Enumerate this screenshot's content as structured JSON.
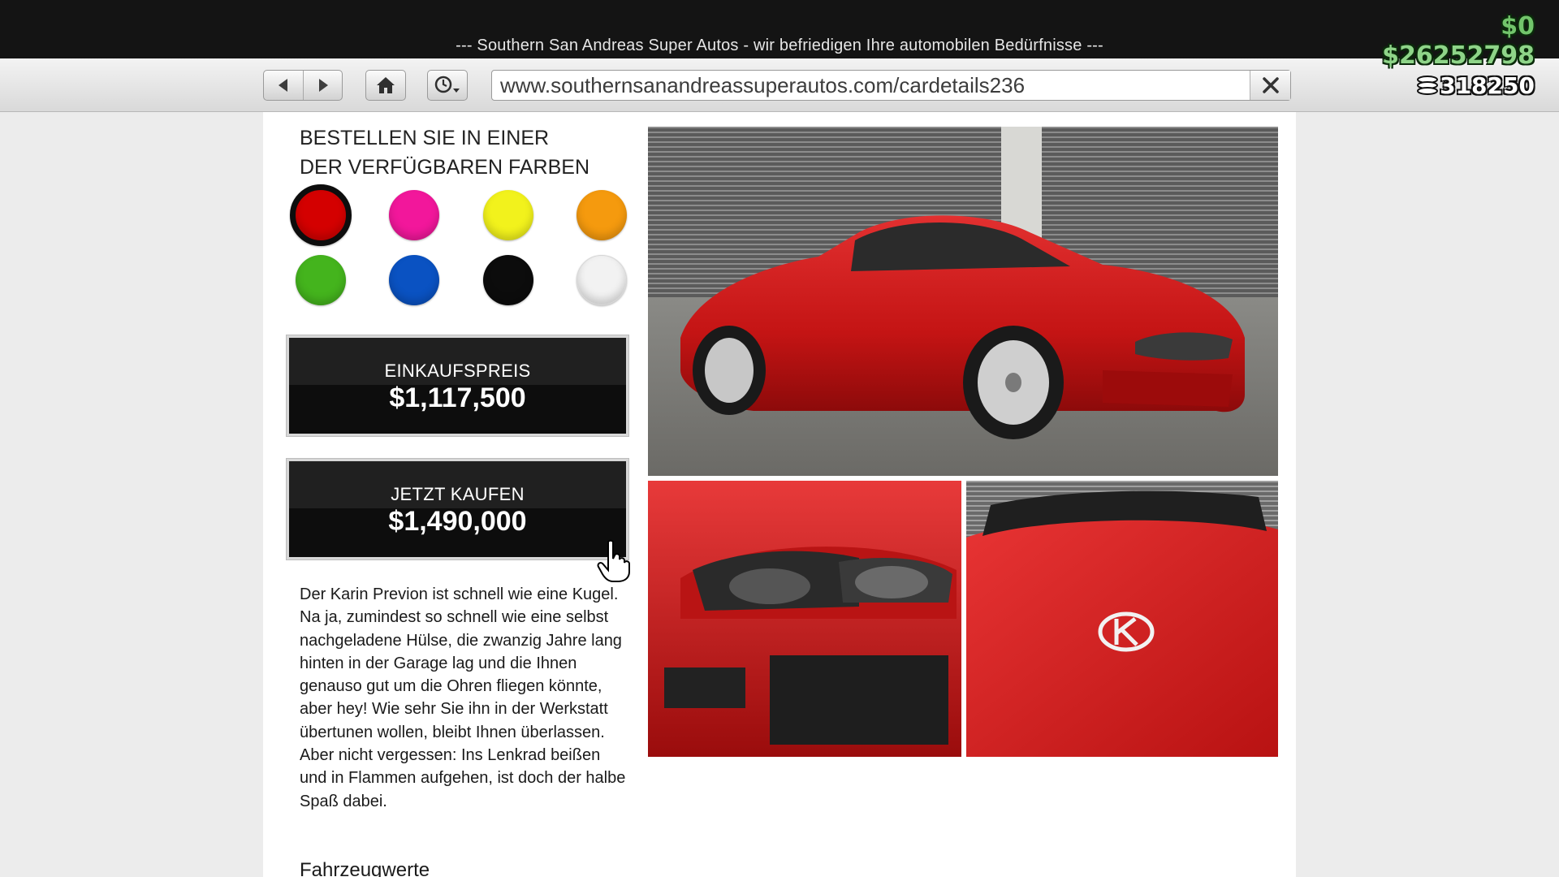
{
  "window": {
    "title": "--- Southern San Andreas Super Autos - wir befriedigen Ihre automobilen Bedürfnisse ---"
  },
  "toolbar": {
    "back_icon": "back-arrow-icon",
    "forward_icon": "forward-arrow-icon",
    "home_icon": "home-icon",
    "history_icon": "history-clock-icon",
    "url": "www.southernsanandreassuperautos.com/cardetails236",
    "close_icon": "close-icon"
  },
  "hud": {
    "cash": "$0",
    "bank": "$26252798",
    "chips": "318250",
    "chips_icon": "chips-icon"
  },
  "colors": {
    "heading": "BESTELLEN SIE IN EINER DER VERFÜGBAREN FARBEN",
    "swatches": [
      {
        "name": "red",
        "hex": "#d40000",
        "selected": true
      },
      {
        "name": "pink",
        "hex": "#f2179b",
        "selected": false
      },
      {
        "name": "yellow",
        "hex": "#f2f21c",
        "selected": false
      },
      {
        "name": "orange",
        "hex": "#f59a0e",
        "selected": false
      },
      {
        "name": "green",
        "hex": "#44b41d",
        "selected": false
      },
      {
        "name": "blue",
        "hex": "#0a52c2",
        "selected": false
      },
      {
        "name": "black",
        "hex": "#0c0c0c",
        "selected": false
      },
      {
        "name": "white",
        "hex": "#f2f2f2",
        "selected": false
      }
    ]
  },
  "purchase": {
    "trade_label": "EINKAUFSPREIS",
    "trade_price": "$1,117,500",
    "buy_label": "JETZT KAUFEN",
    "buy_price": "$1,490,000"
  },
  "description": "Der Karin Previon ist schnell wie eine Kugel. Na ja, zumindest so schnell wie eine selbst nachgeladene Hülse, die zwanzig Jahre lang hinten in der Garage lag und die Ihnen genauso gut um die Ohren fliegen könnte, aber hey! Wie sehr Sie ihn in der Werkstatt übertunen wollen, bleibt Ihnen überlassen. Aber nicht vergessen: Ins Lenkrad beißen und in Flammen aufgehen, ist doch der halbe Spaß dabei.",
  "stats_heading": "Fahrzeugwerte",
  "images": {
    "main": "red-coupe-photo",
    "headlight": "headlight-closeup-photo",
    "hood": "hood-badge-closeup-photo"
  },
  "accent_colors": {
    "car_red": "#d41a1a",
    "hud_green": "#72c56b"
  }
}
